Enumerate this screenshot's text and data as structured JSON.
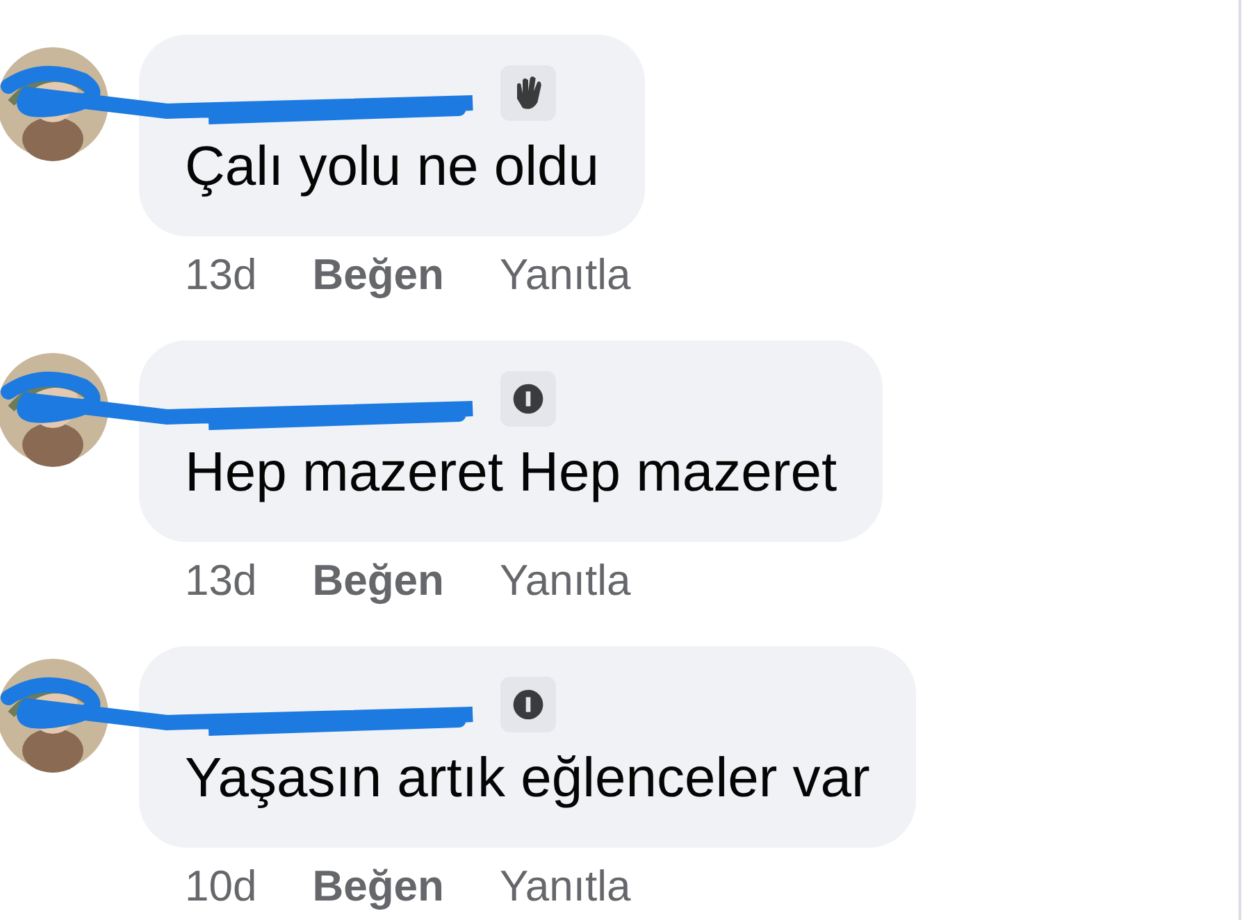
{
  "comments": [
    {
      "kind": "wave",
      "text": "Çalı yolu ne oldu",
      "time": "13d",
      "like": "Beğen",
      "reply": "Yanıtla"
    },
    {
      "kind": "fan",
      "text": "Hep mazeret Hep mazeret",
      "time": "13d",
      "like": "Beğen",
      "reply": "Yanıtla"
    },
    {
      "kind": "fan",
      "text": "Yaşasın artık eğlenceler var",
      "time": "10d",
      "like": "Beğen",
      "reply": "Yanıtla"
    }
  ]
}
